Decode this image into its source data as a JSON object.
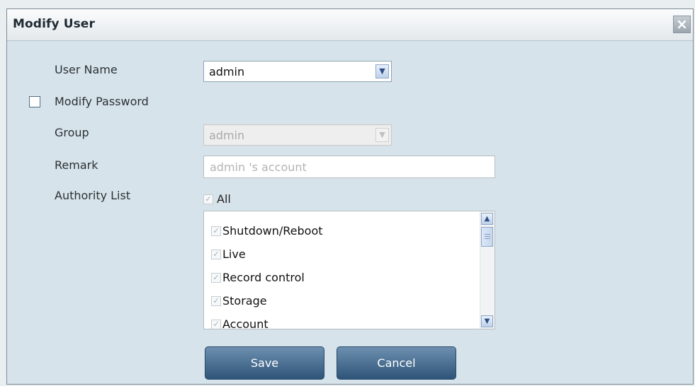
{
  "dialog": {
    "title": "Modify User"
  },
  "form": {
    "user_name": {
      "label": "User Name",
      "value": "admin"
    },
    "modify_password": {
      "label": "Modify Password",
      "checked": false
    },
    "group": {
      "label": "Group",
      "value": "admin"
    },
    "remark": {
      "label": "Remark",
      "placeholder": "admin 's account"
    },
    "authority": {
      "label": "Authority List",
      "all_label": "All",
      "items": [
        "Shutdown/Reboot",
        "Live",
        "Record control",
        "Storage",
        "Account"
      ]
    }
  },
  "buttons": {
    "save": "Save",
    "cancel": "Cancel"
  },
  "icons": {
    "close": "close-icon",
    "dropdown": "chevron-down-icon",
    "scroll_up": "scroll-up-arrow-icon",
    "scroll_down": "scroll-down-arrow-icon",
    "check": "checkmark-icon"
  },
  "colors": {
    "dialog_body": "#d7e3ea",
    "button": "#3f6588",
    "title_text": "#1f2a33"
  }
}
